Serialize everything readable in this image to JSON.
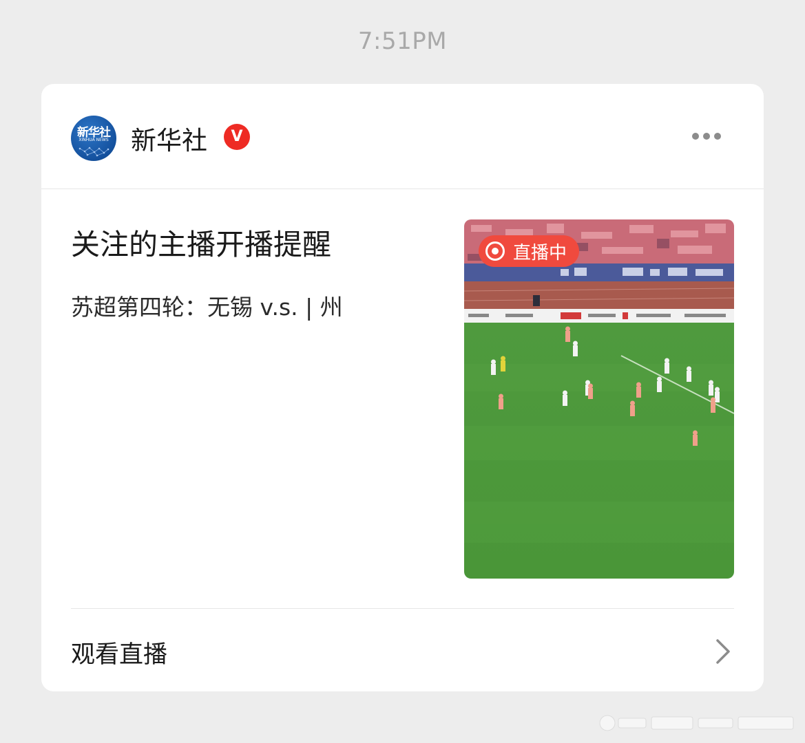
{
  "status": {
    "time": "7:51PM"
  },
  "card": {
    "account": {
      "name": "新华社",
      "avatar_text": "新华社",
      "avatar_subtext": "XINHUA NEWS",
      "verified_icon": "verified-v-icon",
      "verified_color": "#ee2b24"
    },
    "more_icon": "more-dots-icon",
    "title": "关注的主播开播提醒",
    "description": "苏超第四轮：无锡 v.s. | 州",
    "thumbnail": {
      "live_badge_label": "直播中",
      "live_badge_color": "#f04a3e",
      "live_icon": "live-record-icon"
    },
    "action": {
      "label": "观看直播",
      "chevron_icon": "chevron-right-icon"
    }
  }
}
